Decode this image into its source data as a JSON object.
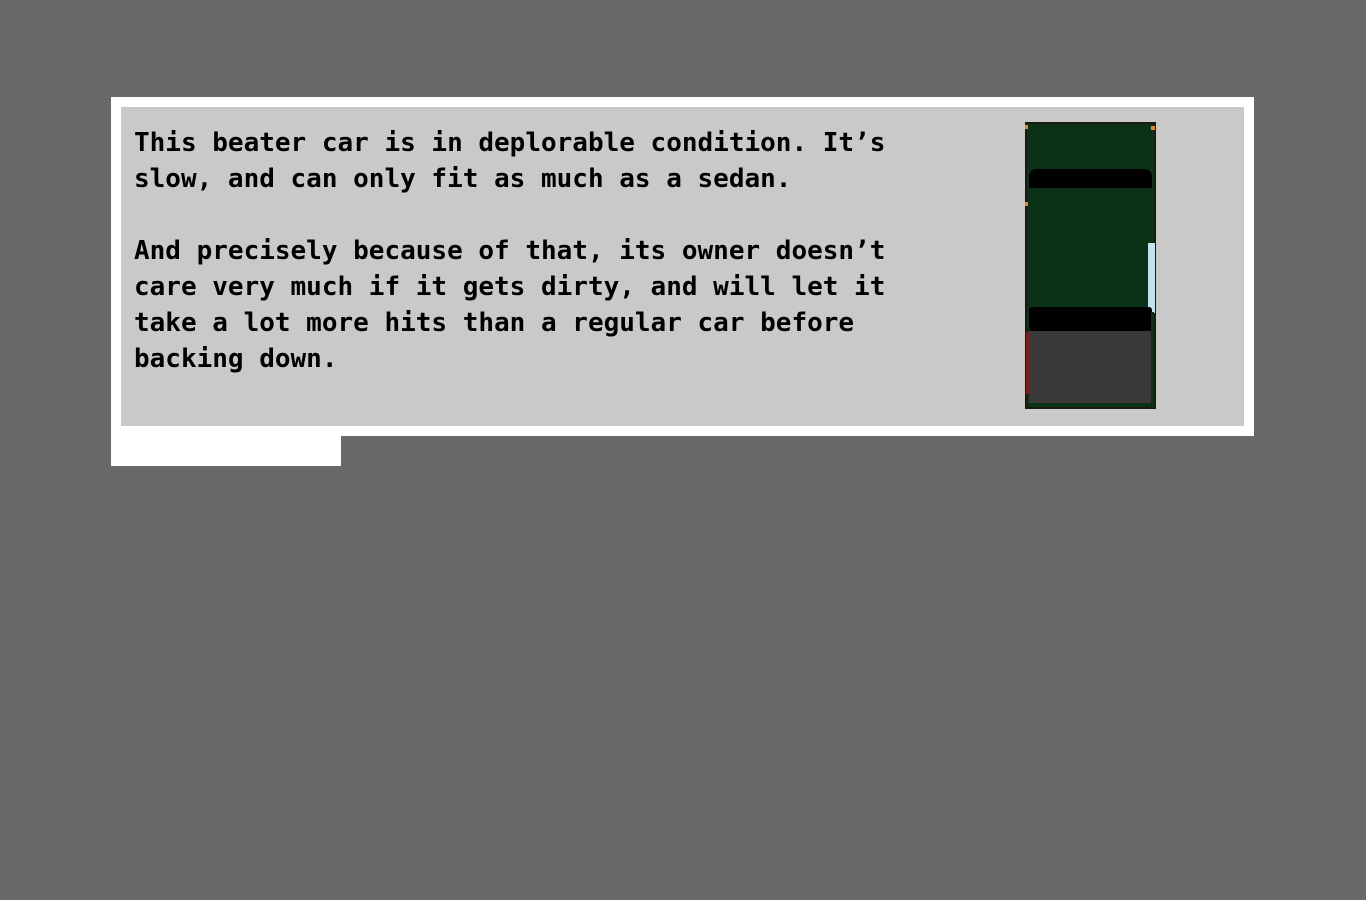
{
  "dialog": {
    "paragraphs": [
      "This beater car is in deplorable condition. It’s slow, and can only fit as much as a sedan.",
      "And precisely because of that, its owner doesn’t care very much if it gets dirty, and will let it take a lot more hits than a regular car before backing down."
    ]
  },
  "sprite": {
    "icon": "beater-car-icon",
    "colors": {
      "body": "#0b3216",
      "windows": "#000000",
      "rear": "#393939",
      "glass_side": "#bfe4ec",
      "rust": "#7a1d1d",
      "headlight": "#e08a2a"
    }
  },
  "colors": {
    "background": "#686868",
    "frame": "#ffffff",
    "panel": "#c9c9c9",
    "text": "#000000"
  }
}
